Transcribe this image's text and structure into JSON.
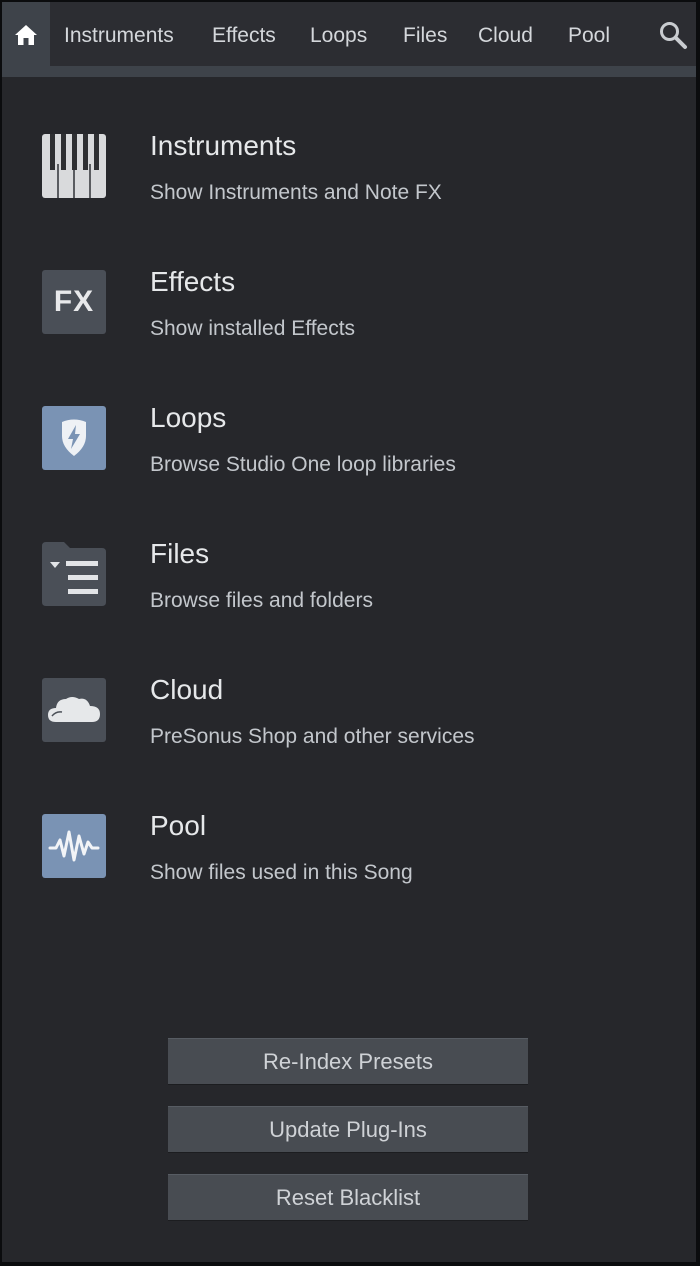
{
  "tabs": {
    "home_icon": "home-icon",
    "items": [
      "Instruments",
      "Effects",
      "Loops",
      "Files",
      "Cloud",
      "Pool"
    ],
    "search_icon": "search-icon"
  },
  "rows": [
    {
      "title": "Instruments",
      "desc": "Show Instruments and Note FX",
      "icon": "piano-keys-icon"
    },
    {
      "title": "Effects",
      "desc": "Show installed Effects",
      "icon": "fx-icon",
      "icon_text": "FX"
    },
    {
      "title": "Loops",
      "desc": "Browse Studio One loop libraries",
      "icon": "loops-shield-icon"
    },
    {
      "title": "Files",
      "desc": "Browse files and folders",
      "icon": "folder-list-icon"
    },
    {
      "title": "Cloud",
      "desc": "PreSonus Shop and other services",
      "icon": "cloud-icon"
    },
    {
      "title": "Pool",
      "desc": "Show files used in this Song",
      "icon": "waveform-icon"
    }
  ],
  "buttons": {
    "reindex": "Re-Index Presets",
    "update": "Update Plug-Ins",
    "reset": "Reset Blacklist"
  },
  "colors": {
    "panel_bg": "#26272b",
    "tabbar_bg": "#2c2d32",
    "accent_blue": "#7a93b4",
    "icon_gray": "#4a4f57"
  }
}
